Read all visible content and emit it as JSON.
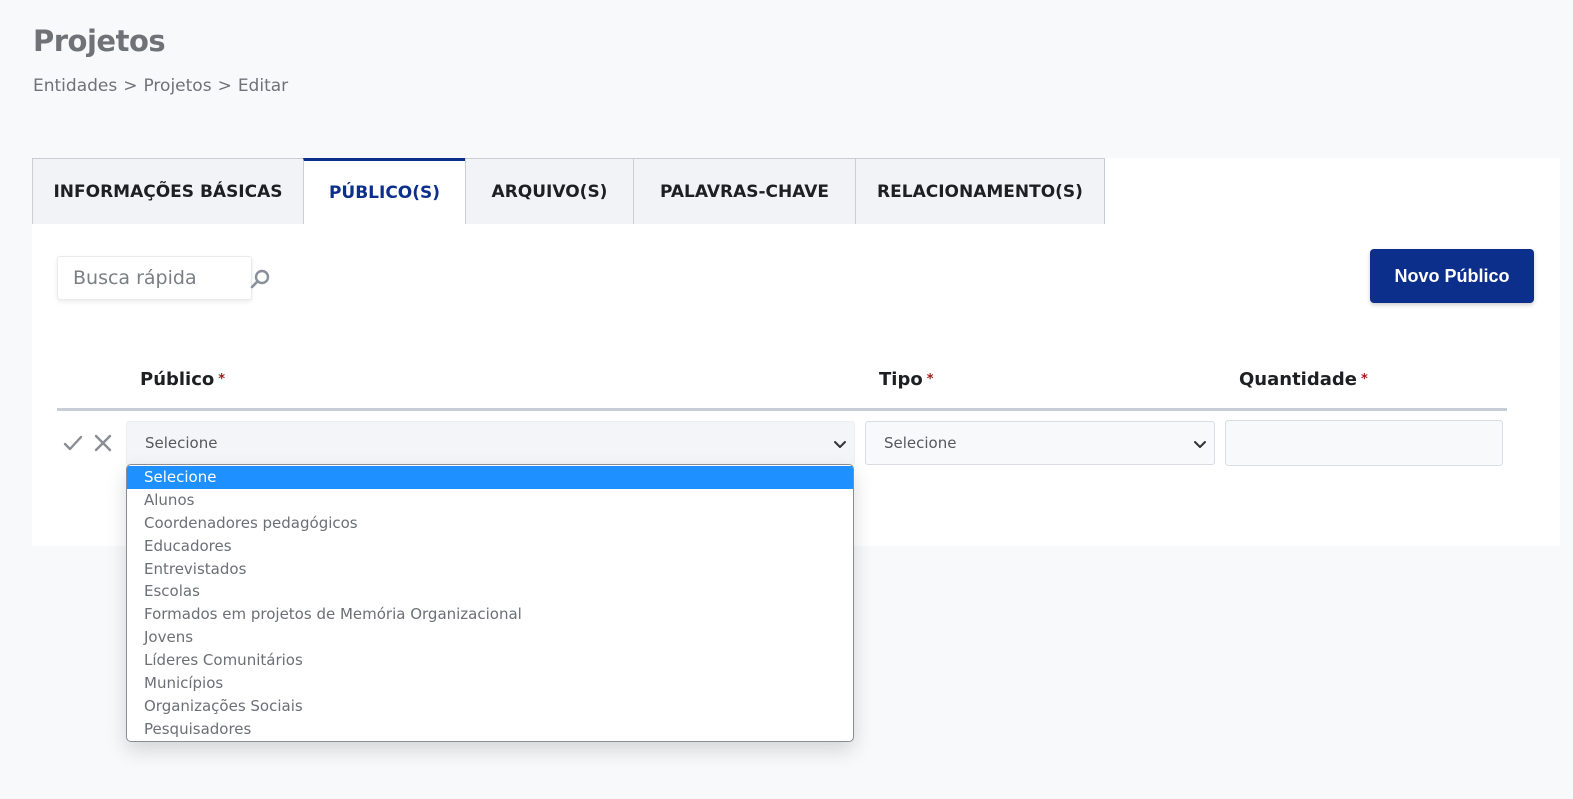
{
  "page": {
    "title": "Projetos",
    "breadcrumb": [
      "Entidades",
      ">",
      "Projetos",
      ">",
      "Editar"
    ]
  },
  "tabs": [
    {
      "label": "INFORMAÇÕES BÁSICAS",
      "active": false
    },
    {
      "label": "PÚBLICO(S)",
      "active": true
    },
    {
      "label": "ARQUIVO(S)",
      "active": false
    },
    {
      "label": "PALAVRAS-CHAVE",
      "active": false
    },
    {
      "label": "RELACIONAMENTO(S)",
      "active": false
    }
  ],
  "toolbar": {
    "search_placeholder": "Busca rápida",
    "search_icon": "search-icon",
    "new_button_label": "Novo Público"
  },
  "table": {
    "columns": [
      {
        "label": "Público",
        "required_mark": "*"
      },
      {
        "label": "Tipo",
        "required_mark": "*"
      },
      {
        "label": "Quantidade",
        "required_mark": "*"
      }
    ],
    "edit_row": {
      "confirm_icon": "check-icon",
      "cancel_icon": "close-icon",
      "publico_value": "Selecione",
      "tipo_value": "Selecione",
      "quantidade_value": ""
    }
  },
  "publico_dropdown": {
    "selected": "Selecione",
    "options": [
      "Selecione",
      "Alunos",
      "Coordenadores pedagógicos",
      "Educadores",
      "Entrevistados",
      "Escolas",
      "Formados em projetos de Memória Organizacional",
      "Jovens",
      "Líderes Comunitários",
      "Municípios",
      "Organizações Sociais",
      "Pesquisadores"
    ]
  },
  "colors": {
    "primary": "#0d2f8c",
    "highlight": "#1e90ff",
    "required": "#a31b1b",
    "page_background": "#f8f9fb"
  }
}
